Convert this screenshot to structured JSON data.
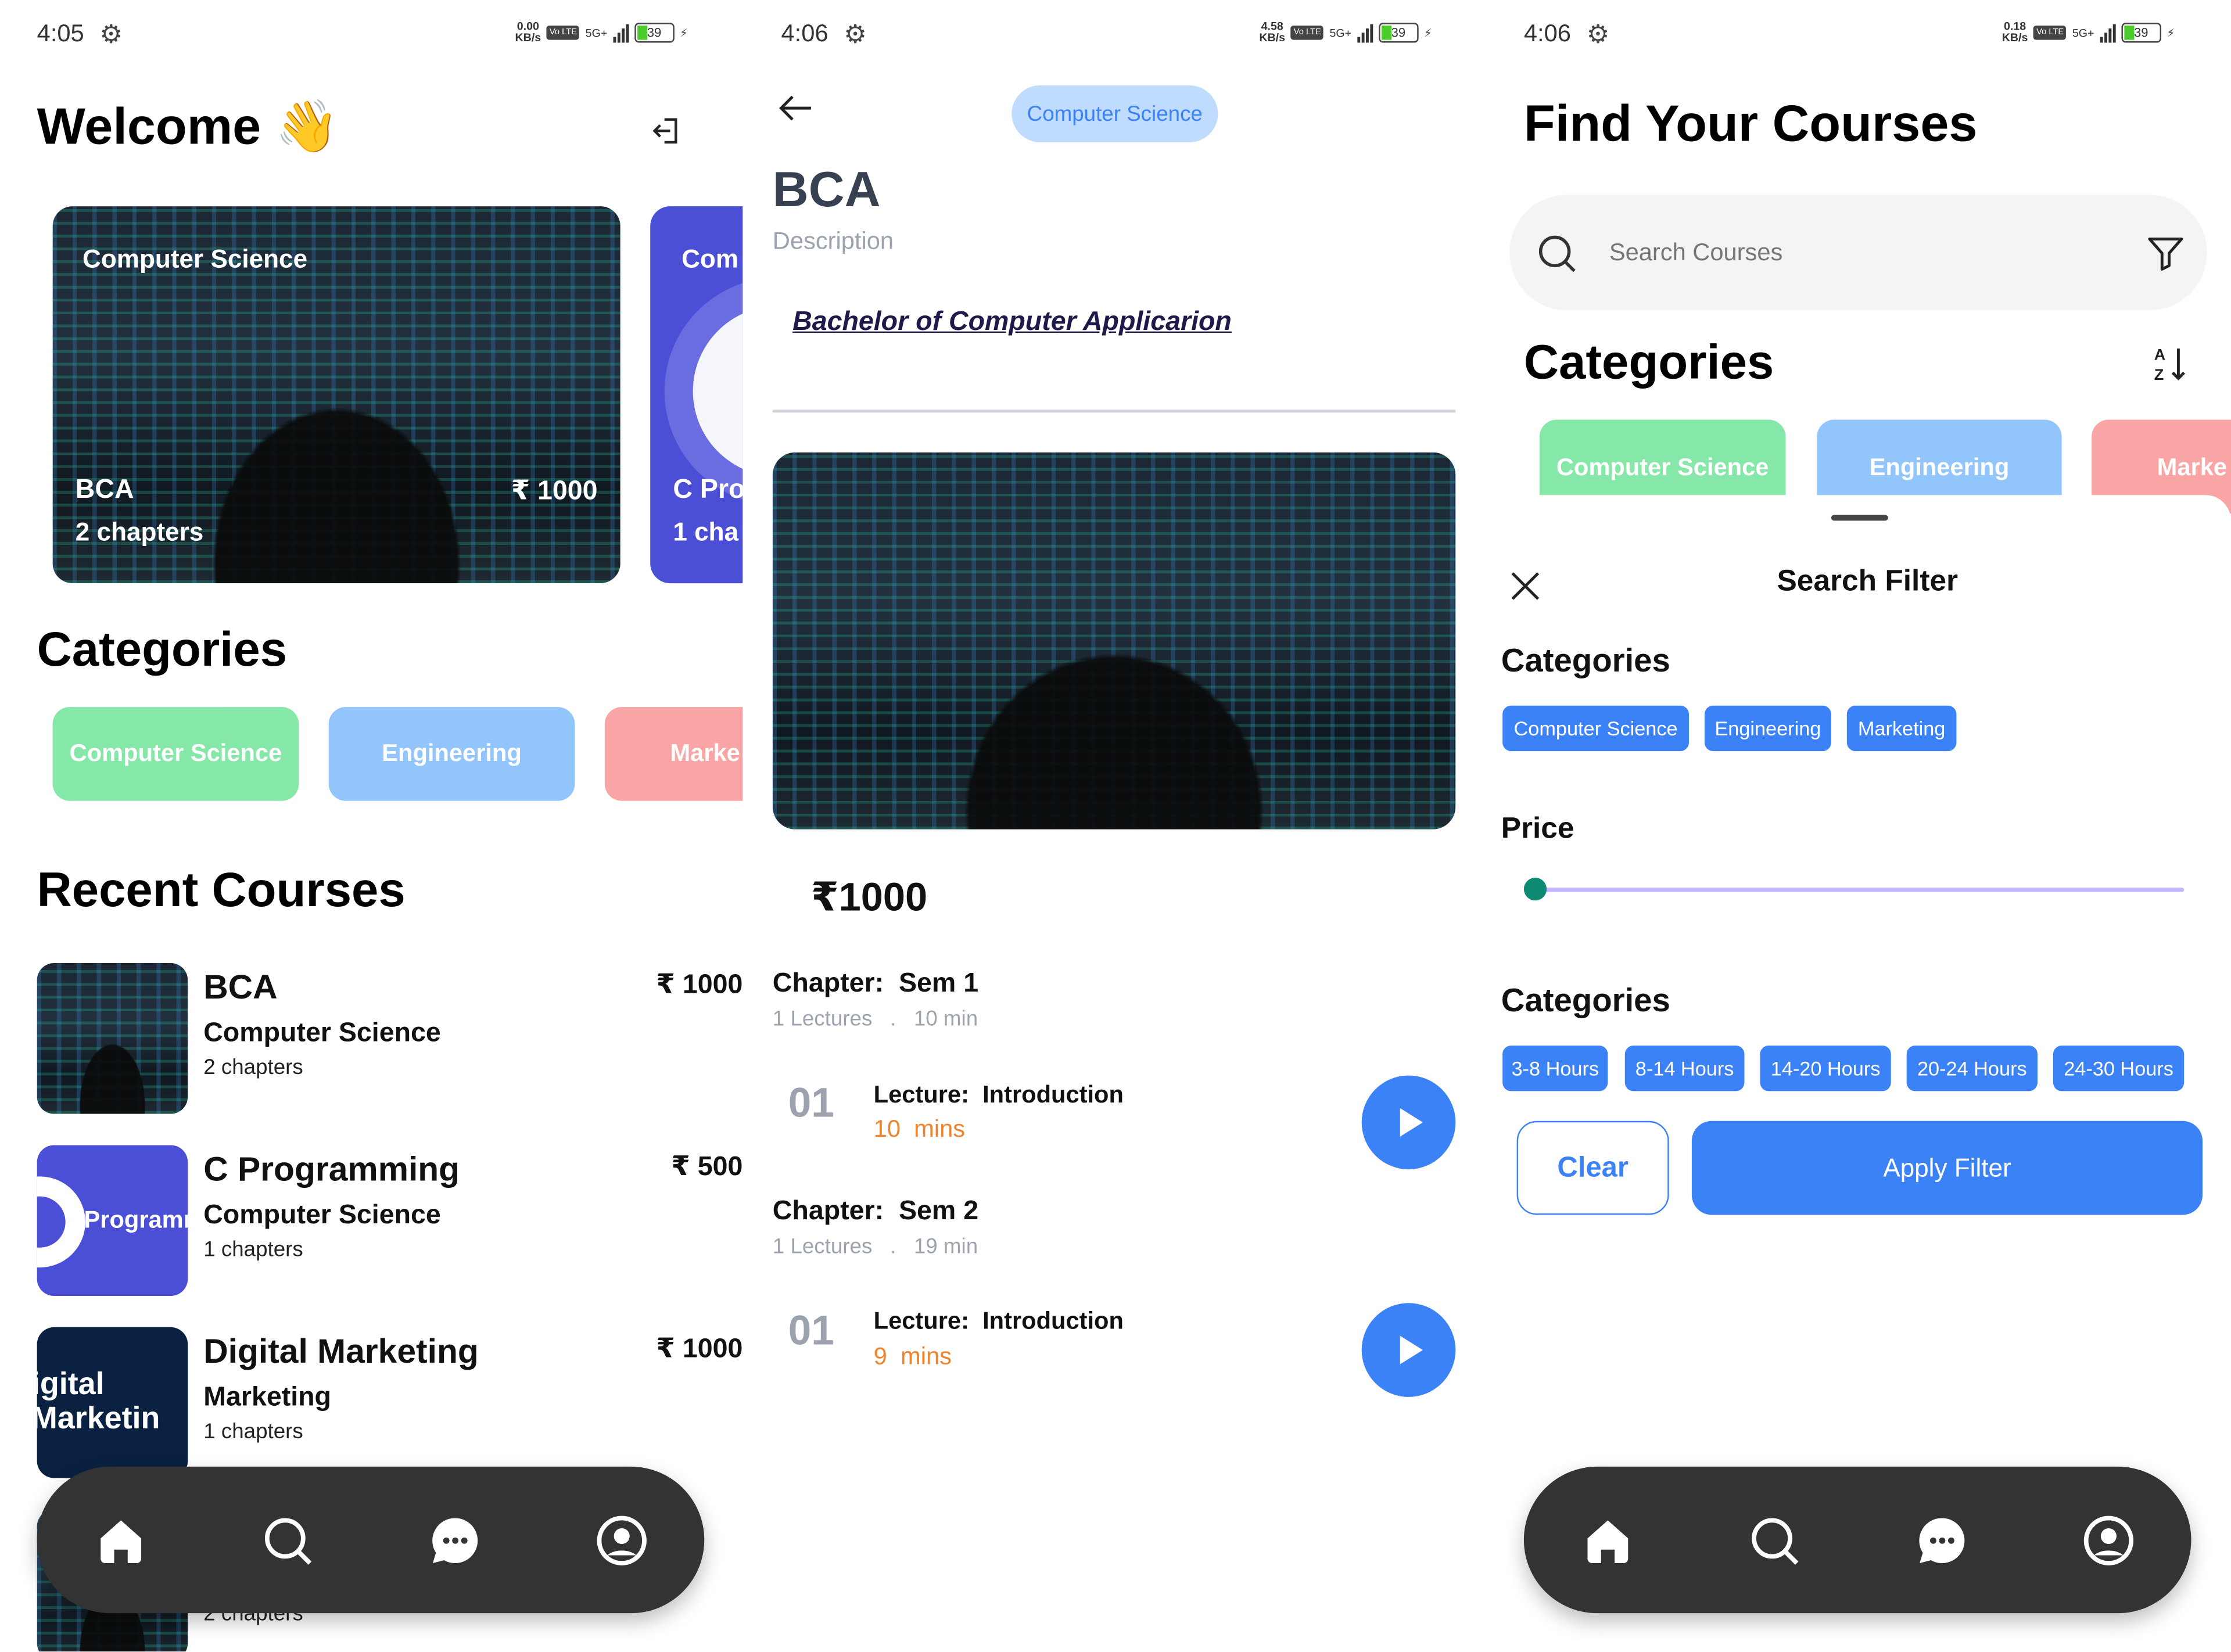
{
  "home": {
    "status": {
      "time": "4:05",
      "net_speed": "0.00",
      "net_unit": "KB/s",
      "network": "5G+",
      "volte": "Vo LTE",
      "battery": "39"
    },
    "title": "Welcome",
    "title_emoji": "👋",
    "icons": {
      "logout": "logout-icon"
    },
    "featured": [
      {
        "label": "Computer Science",
        "title": "BCA",
        "price": "₹ 1000",
        "chapters": "2 chapters"
      },
      {
        "label": "Com",
        "title": "C Pro",
        "chapters": "1 cha"
      }
    ],
    "categories_heading": "Categories",
    "categories": [
      {
        "label": "Computer Science",
        "color": "#86e8a8"
      },
      {
        "label": "Engineering",
        "color": "#93c5fd"
      },
      {
        "label": "Marke",
        "color": "#f9a5a5"
      }
    ],
    "recent_heading": "Recent Courses",
    "recent": [
      {
        "title": "BCA",
        "category": "Computer Science",
        "chapters": "2 chapters",
        "price": "₹ 1000",
        "thumb_text": ""
      },
      {
        "title": "C Programming",
        "category": "Computer Science",
        "chapters": "1 chapters",
        "price": "₹ 500",
        "thumb_text": "Programm"
      },
      {
        "title": "Digital Marketing",
        "category": "Marketing",
        "chapters": "1 chapters",
        "price": "₹ 1000",
        "thumb_text": "igital Marketin"
      },
      {
        "title": "",
        "category": "",
        "chapters": "2 chapters",
        "price": "",
        "thumb_text": ""
      }
    ]
  },
  "detail": {
    "status": {
      "time": "4:06",
      "net_speed": "4.58",
      "net_unit": "KB/s",
      "network": "5G+",
      "volte": "Vo LTE",
      "battery": "39"
    },
    "category_pill": "Computer Science",
    "title": "BCA",
    "description_label": "Description",
    "description": "Bachelor of Computer Applicarion",
    "price": "₹1000",
    "chapters": [
      {
        "label": "Chapter:",
        "name": "Sem 1",
        "lectures": "1 Lectures",
        "sep": ".",
        "duration": "10 min",
        "lecture": {
          "num": "01",
          "label": "Lecture:",
          "name": "Introduction",
          "mins": "10",
          "mins_unit": "mins"
        }
      },
      {
        "label": "Chapter:",
        "name": "Sem 2",
        "lectures": "1 Lectures",
        "sep": ".",
        "duration": "19 min",
        "lecture": {
          "num": "01",
          "label": "Lecture:",
          "name": "Introduction",
          "mins": "9",
          "mins_unit": "mins"
        }
      }
    ]
  },
  "search": {
    "status": {
      "time": "4:06",
      "net_speed": "0.18",
      "net_unit": "KB/s",
      "network": "5G+",
      "volte": "Vo LTE",
      "battery": "39"
    },
    "title": "Find Your Courses",
    "search_placeholder": "Search Courses",
    "categories_heading": "Categories",
    "categories": [
      {
        "label": "Computer Science",
        "color": "#86e8a8"
      },
      {
        "label": "Engineering",
        "color": "#93c5fd"
      },
      {
        "label": "Marke",
        "color": "#f9a5a5"
      }
    ],
    "filter": {
      "title": "Search Filter",
      "categories_heading": "Categories",
      "categories": [
        "Computer Science",
        "Engineering",
        "Marketing"
      ],
      "price_heading": "Price",
      "price_slider_value": 0,
      "hours_heading": "Categories",
      "hours": [
        "3-8 Hours",
        "8-14 Hours",
        "14-20 Hours",
        "20-24 Hours",
        "24-30 Hours"
      ],
      "clear_label": "Clear",
      "apply_label": "Apply Filter"
    }
  },
  "colors": {
    "accent": "#3b82f6",
    "nav_bg": "#333333",
    "slider_thumb": "#0f8a72",
    "slider_track": "#c4b5fd",
    "orange": "#f0842c"
  }
}
